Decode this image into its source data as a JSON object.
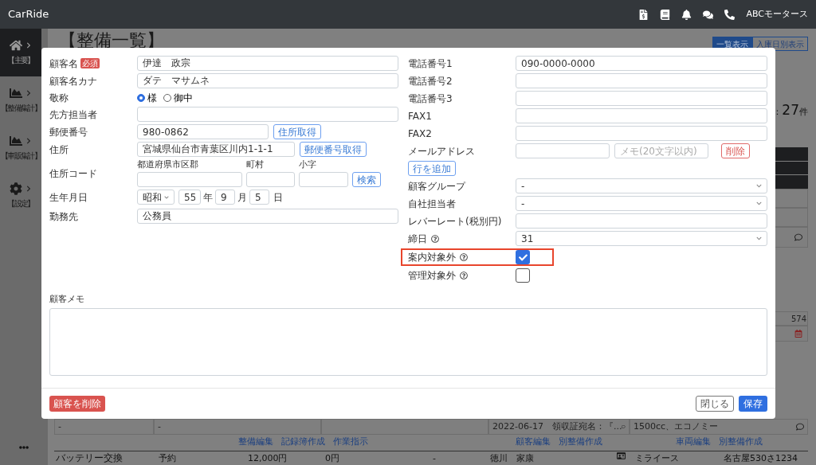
{
  "app": {
    "brand": "CarRide",
    "company": "ABCモータース"
  },
  "sidebar": [
    {
      "label": "【主要】",
      "selected": true
    },
    {
      "label": "【整備集計】",
      "selected": false
    },
    {
      "label": "【車販集計】",
      "selected": false
    },
    {
      "label": "【設定】",
      "selected": false
    }
  ],
  "background": {
    "title": "【整備一覧】",
    "view_buttons": [
      {
        "label": "一覧表示",
        "selected": true
      },
      {
        "label": "入庫日別表示",
        "selected": false
      }
    ],
    "count": {
      "prefix": "：",
      "number": "27",
      "unit": "件"
    },
    "side_cell": "574",
    "row": {
      "col1": "-",
      "col2": "-",
      "receipt": "2022-06-17　領収証宛名：『...",
      "vehicle": "1500cc、エコノミー"
    },
    "link_groups": [
      [
        "整備編集",
        "記録簿作成",
        "作業指示"
      ],
      [
        "顧客編集",
        "別整備作成"
      ],
      [
        "車両編集",
        "別整備作成"
      ]
    ],
    "next_row": {
      "work": "バッテリー交換",
      "status": "予約",
      "amount": "12,000円",
      "paid": "0円",
      "note": "-",
      "customer": "徳川　家康",
      "car": "ミライース",
      "plate": "名古屋530さ1234"
    }
  },
  "modal": {
    "left_fields": [
      {
        "kind": "text",
        "label": "顧客名",
        "badge": "必須",
        "value": "伊達　政宗"
      },
      {
        "kind": "text",
        "label": "顧客名カナ",
        "value": "ダテ　マサムネ"
      },
      {
        "kind": "radio",
        "label": "敬称",
        "options": [
          {
            "label": "様",
            "selected": true
          },
          {
            "label": "御中",
            "selected": false
          }
        ]
      },
      {
        "kind": "text",
        "label": "先方担当者"
      },
      {
        "kind": "postal",
        "label": "郵便番号",
        "value": "980-0862",
        "button": "住所取得"
      },
      {
        "kind": "address",
        "label": "住所",
        "value": "宮城県仙台市青葉区川内1-1-1",
        "button": "郵便番号取得"
      },
      {
        "kind": "address_code",
        "label": "住所コード",
        "parts": [
          "都道府県市区郡",
          "町村",
          "小字"
        ],
        "button": "検索"
      },
      {
        "kind": "date",
        "label": "生年月日",
        "era": "昭和",
        "year": "55",
        "year_unit": "年",
        "month": "9",
        "month_unit": "月",
        "day": "5",
        "day_unit": "日"
      },
      {
        "kind": "text",
        "label": "勤務先",
        "value": "公務員"
      }
    ],
    "right_fields": [
      {
        "kind": "text",
        "label": "電話番号1",
        "value": "090-0000-0000"
      },
      {
        "kind": "text",
        "label": "電話番号2"
      },
      {
        "kind": "text",
        "label": "電話番号3"
      },
      {
        "kind": "text",
        "label": "FAX1"
      },
      {
        "kind": "text",
        "label": "FAX2"
      },
      {
        "kind": "email",
        "label": "メールアドレス",
        "memo_placeholder": "メモ(20文字以内)",
        "button": "削除"
      },
      {
        "kind": "add",
        "button": "行を追加"
      },
      {
        "kind": "select",
        "label": "顧客グループ",
        "value": "-"
      },
      {
        "kind": "select",
        "label": "自社担当者",
        "value": "-"
      },
      {
        "kind": "text",
        "label": "レバーレート(税別円)"
      },
      {
        "kind": "select",
        "label": "締日",
        "help": true,
        "value": "31"
      },
      {
        "kind": "checkbox",
        "label": "案内対象外",
        "help": true,
        "checked": true,
        "highlighted": true
      },
      {
        "kind": "checkbox",
        "label": "管理対象外",
        "help": true,
        "checked": false,
        "highlighted": false
      }
    ],
    "memo_label": "顧客メモ",
    "delete_button": "顧客を削除",
    "close_button": "閉じる",
    "save_button": "保存"
  }
}
